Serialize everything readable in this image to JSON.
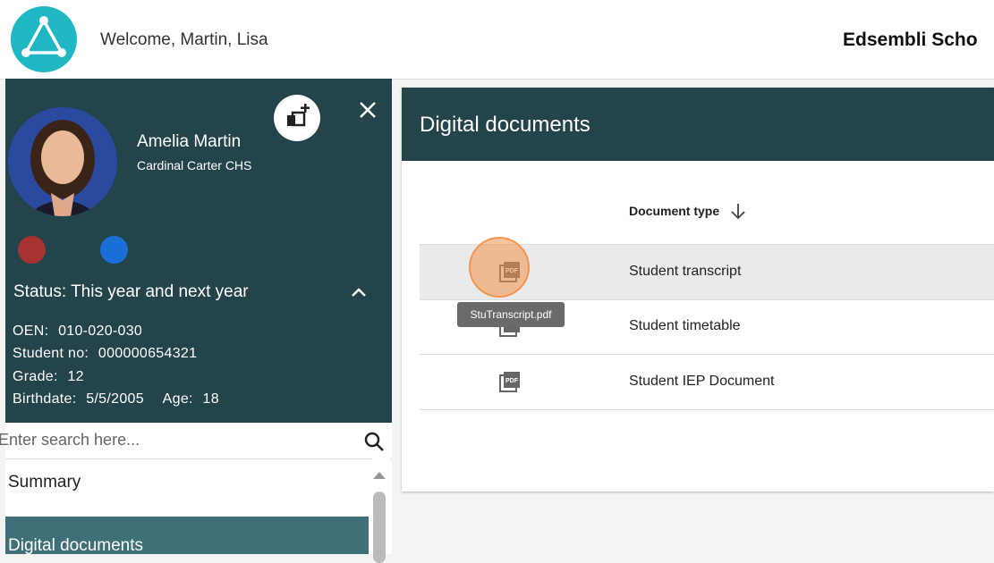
{
  "header": {
    "welcome": "Welcome, Martin, Lisa",
    "brand": "Edsembli Scho"
  },
  "profile": {
    "name": "Amelia Martin",
    "school": "Cardinal Carter CHS",
    "status": "Status: This year and next year",
    "oen_label": "OEN:",
    "oen": "010-020-030",
    "student_no_label": "Student no:",
    "student_no": "000000654321",
    "grade_label": "Grade:",
    "grade": "12",
    "birthdate_label": "Birthdate:",
    "birthdate": "5/5/2005",
    "age_label": "Age:",
    "age": "18",
    "dot_colors": [
      "#a83230",
      "#1a6fd6"
    ]
  },
  "search": {
    "placeholder": "Enter search here..."
  },
  "nav": {
    "items": [
      {
        "label": "Summary"
      },
      {
        "label": "Digital documents"
      }
    ]
  },
  "panel": {
    "title": "Digital documents",
    "column_header": "Document type",
    "rows": [
      {
        "label": "Student transcript",
        "icon": "pdf-icon"
      },
      {
        "label": "Student timetable",
        "icon": "pdf-icon"
      },
      {
        "label": "Student IEP Document",
        "icon": "pdf-icon"
      }
    ],
    "tooltip": "StuTranscript.pdf"
  },
  "colors": {
    "header_bg": "#24444b",
    "active_nav": "#3f7077",
    "logo": "#1fb7c4",
    "highlight": "#f39048"
  }
}
